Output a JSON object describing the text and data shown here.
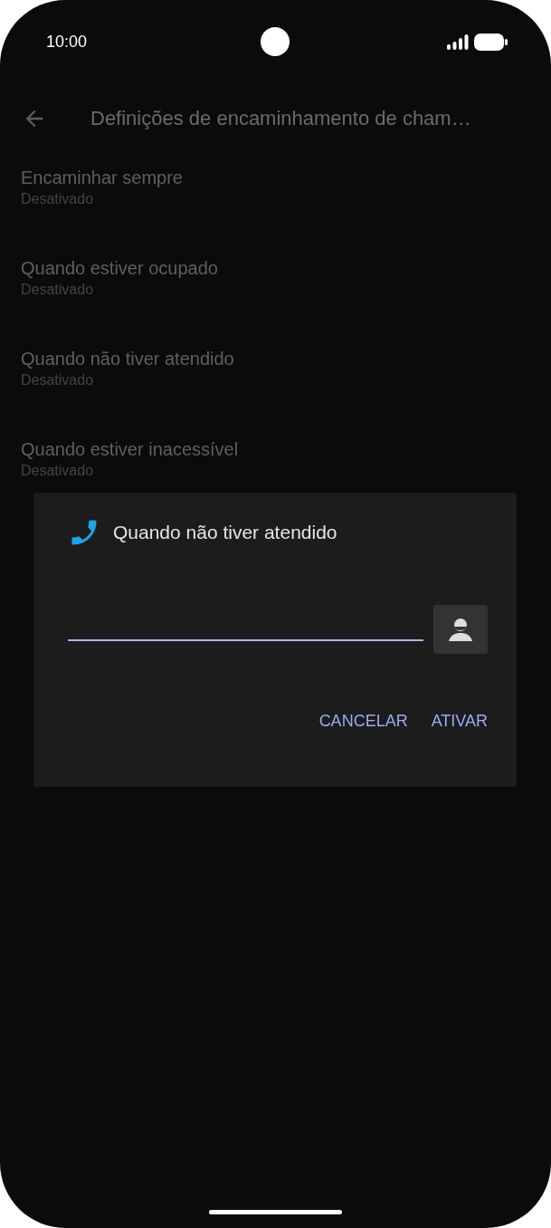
{
  "status_bar": {
    "time": "10:00"
  },
  "toolbar": {
    "title": "Definições de encaminhamento de cham…"
  },
  "settings": [
    {
      "title": "Encaminhar sempre",
      "summary": "Desativado"
    },
    {
      "title": "Quando estiver ocupado",
      "summary": "Desativado"
    },
    {
      "title": "Quando não tiver atendido",
      "summary": "Desativado"
    },
    {
      "title": "Quando estiver inacessível",
      "summary": "Desativado"
    }
  ],
  "dialog": {
    "title": "Quando não tiver atendido",
    "buttons": [
      "CANCELAR",
      "ATIVAR"
    ]
  }
}
